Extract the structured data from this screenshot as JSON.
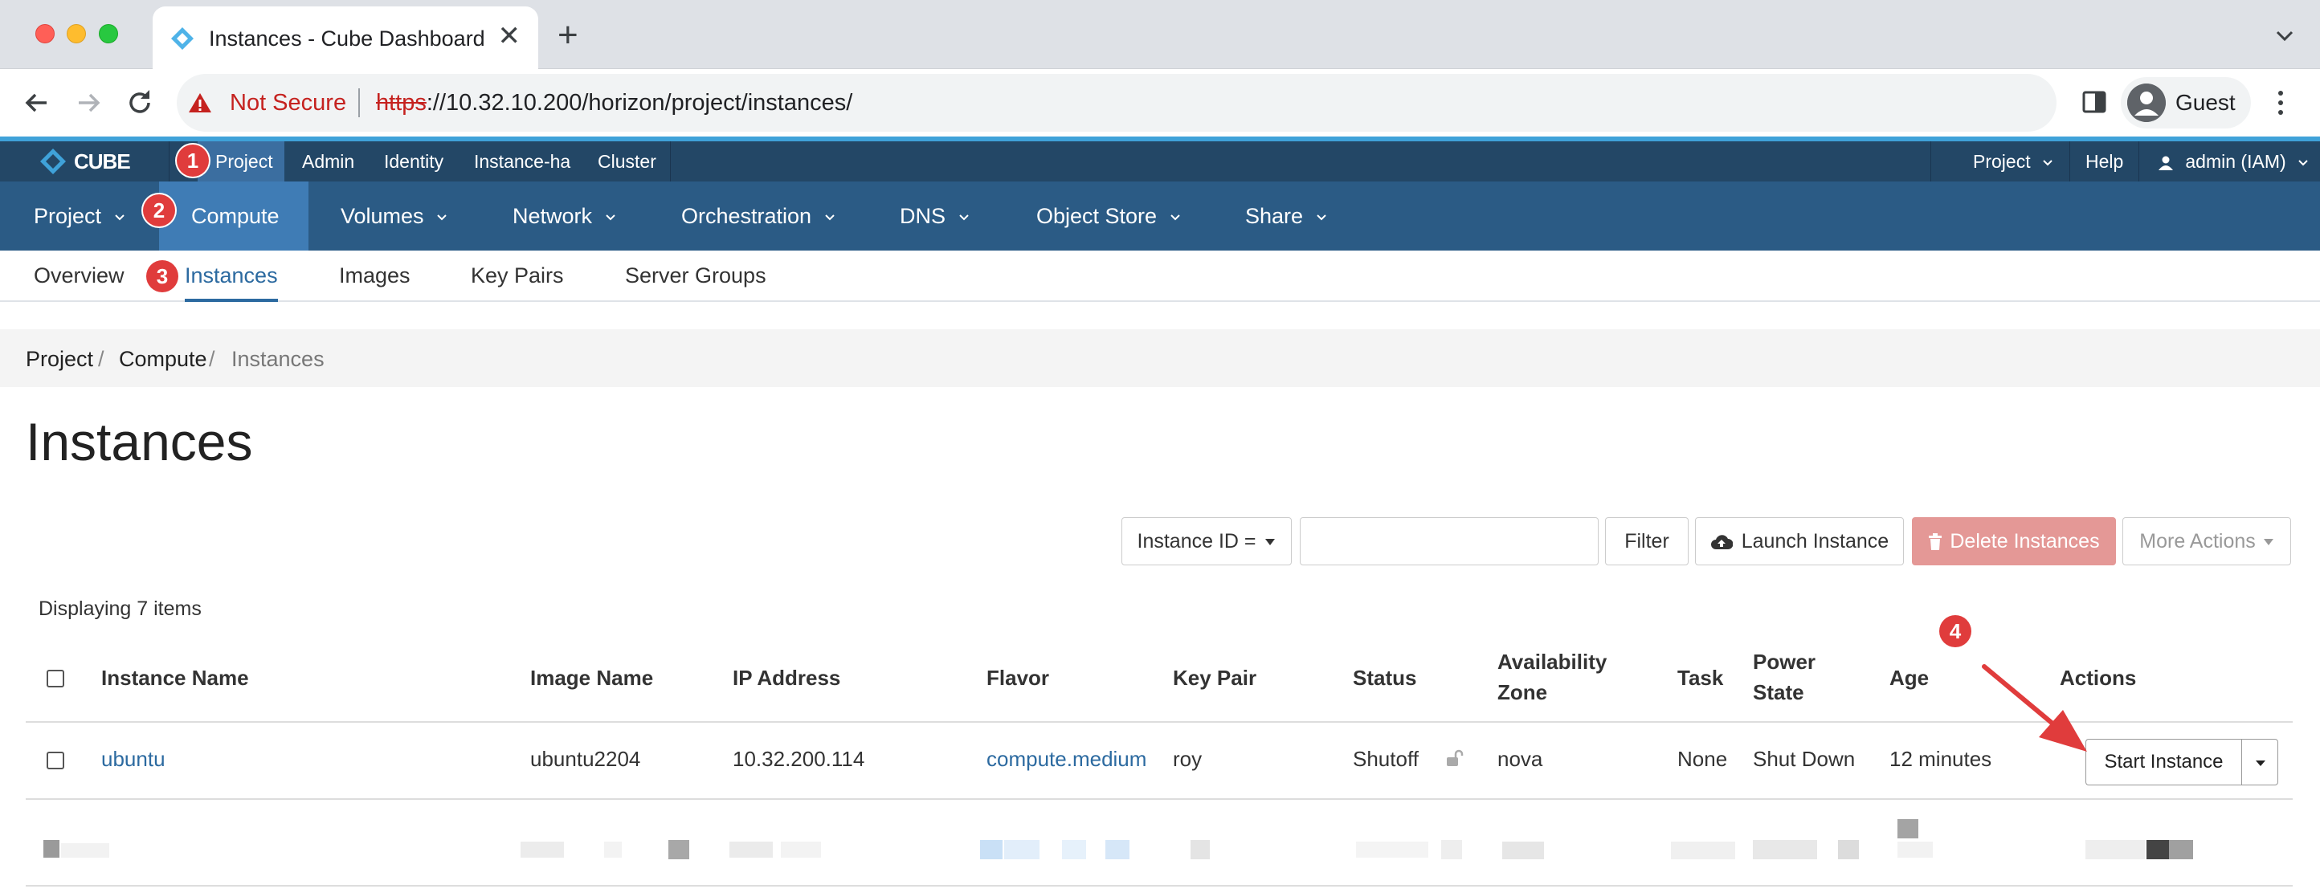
{
  "browser": {
    "tab_title": "Instances - Cube Dashboard",
    "tab_close": "✕",
    "new_tab": "+",
    "security_label": "Not Secure",
    "url_scheme": "https",
    "url_rest": "://10.32.10.200/horizon/project/instances/",
    "profile_label": "Guest"
  },
  "topnav": {
    "logo_text": "CUBE",
    "items": [
      "Project",
      "Admin",
      "Identity",
      "Instance-ha",
      "Cluster"
    ],
    "right_project": "Project",
    "help": "Help",
    "user": "admin (IAM)"
  },
  "secnav": {
    "items": [
      "Project",
      "Compute",
      "Volumes",
      "Network",
      "Orchestration",
      "DNS",
      "Object Store",
      "Share"
    ]
  },
  "tertnav": {
    "items": [
      "Overview",
      "Instances",
      "Images",
      "Key Pairs",
      "Server Groups"
    ]
  },
  "badges": [
    "1",
    "2",
    "3",
    "4"
  ],
  "breadcrumb": {
    "project": "Project",
    "compute": "Compute",
    "sep": "/",
    "current": "Instances"
  },
  "page": {
    "title": "Instances",
    "displaying": "Displaying 7 items"
  },
  "actions": {
    "filter_select": "Instance ID =",
    "filter_placeholder": "",
    "filter": "Filter",
    "launch": "Launch Instance",
    "delete": "Delete Instances",
    "more": "More Actions"
  },
  "table": {
    "headers": {
      "name": "Instance Name",
      "image": "Image Name",
      "ip": "IP Address",
      "flavor": "Flavor",
      "keypair": "Key Pair",
      "status": "Status",
      "az_line1": "Availability",
      "az_line2": "Zone",
      "task": "Task",
      "power_line1": "Power",
      "power_line2": "State",
      "age": "Age",
      "actions": "Actions"
    },
    "rows": [
      {
        "name": "ubuntu",
        "image": "ubuntu2204",
        "ip": "10.32.200.114",
        "flavor": "compute.medium",
        "keypair": "roy",
        "status": "Shutoff",
        "az": "nova",
        "task": "None",
        "power": "Shut Down",
        "age": "12 minutes",
        "action": "Start Instance"
      }
    ]
  },
  "colors": {
    "topnav_bg": "#234766",
    "secnav_bg": "#2b5b85",
    "active_bg": "#3f7cb5",
    "link": "#2c6aa0",
    "badge": "#e03c3c",
    "delete_btn": "#e49896"
  }
}
